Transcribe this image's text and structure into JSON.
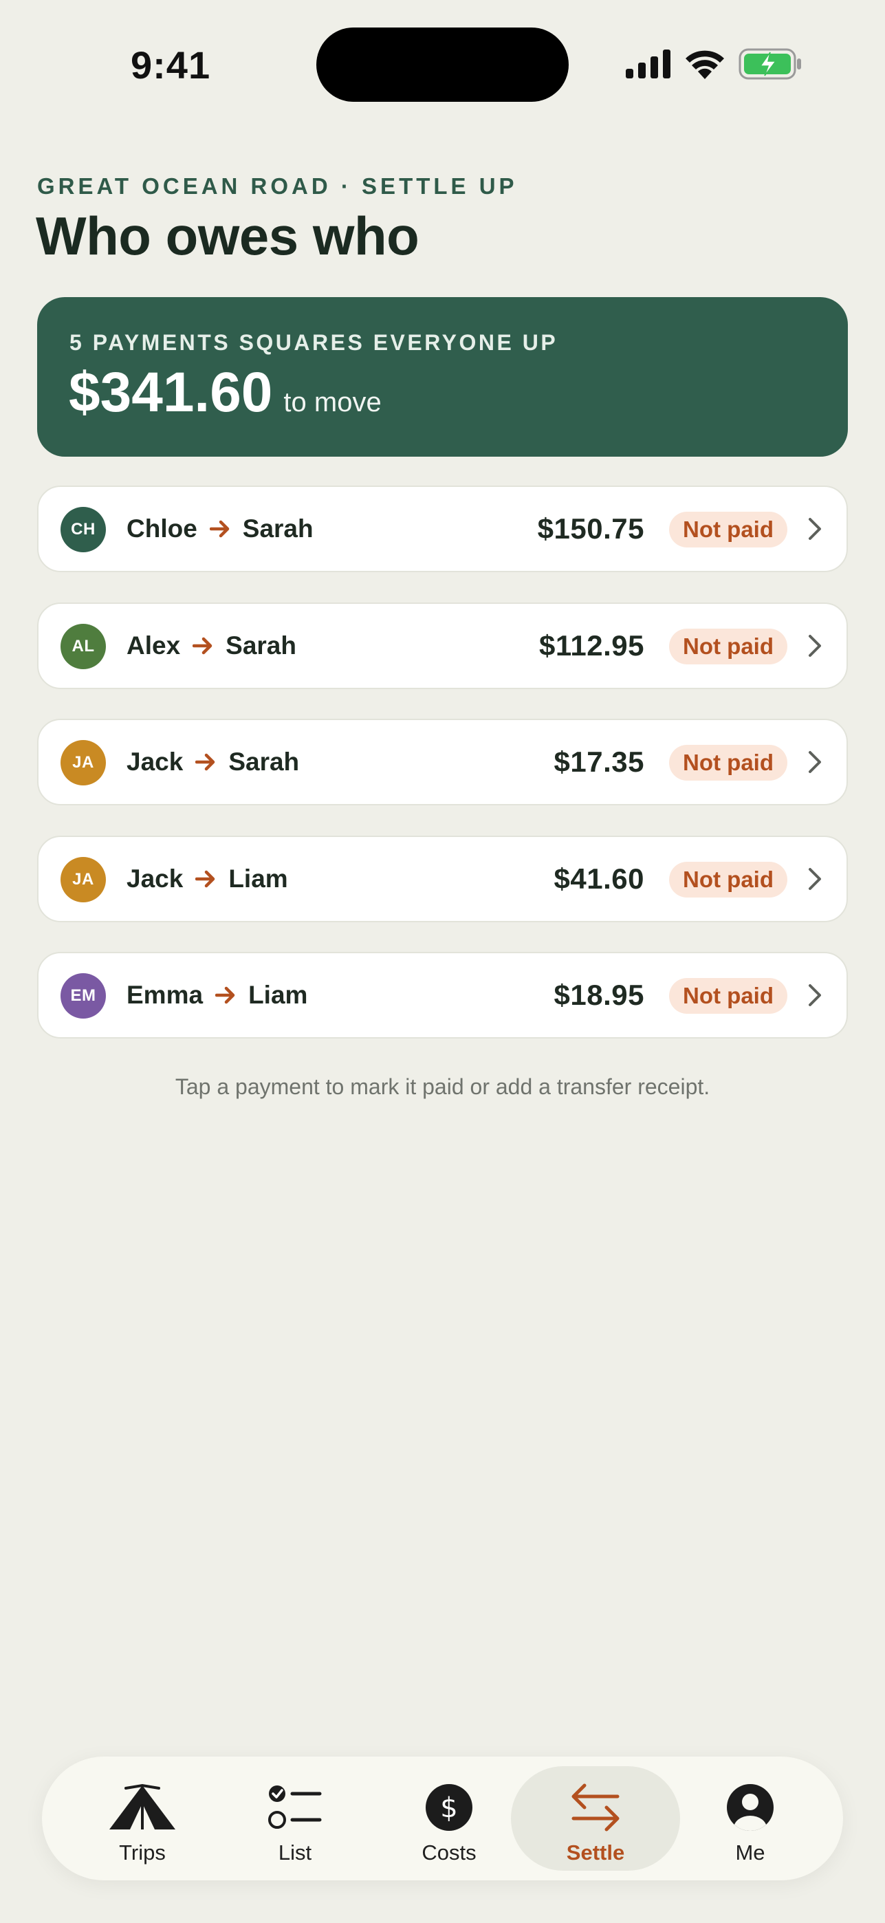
{
  "status_bar": {
    "time": "9:41"
  },
  "header": {
    "eyebrow": "GREAT OCEAN ROAD · SETTLE UP",
    "title": "Who owes who"
  },
  "summary": {
    "label": "5 PAYMENTS SQUARES EVERYONE UP",
    "amount": "$341.60",
    "suffix": "to move"
  },
  "payments": [
    {
      "initials": "CH",
      "from": "Chloe",
      "to": "Sarah",
      "amount": "$150.75",
      "status": "Not paid",
      "avatar_color": "#2f5e4c"
    },
    {
      "initials": "AL",
      "from": "Alex",
      "to": "Sarah",
      "amount": "$112.95",
      "status": "Not paid",
      "avatar_color": "#4f7d3e"
    },
    {
      "initials": "JA",
      "from": "Jack",
      "to": "Sarah",
      "amount": "$17.35",
      "status": "Not paid",
      "avatar_color": "#c98a23"
    },
    {
      "initials": "JA",
      "from": "Jack",
      "to": "Liam",
      "amount": "$41.60",
      "status": "Not paid",
      "avatar_color": "#c98a23"
    },
    {
      "initials": "EM",
      "from": "Emma",
      "to": "Liam",
      "amount": "$18.95",
      "status": "Not paid",
      "avatar_color": "#7a59a3"
    }
  ],
  "hint": "Tap a payment to mark it paid or add a transfer receipt.",
  "tabs": [
    {
      "label": "Trips",
      "icon": "tent-icon"
    },
    {
      "label": "List",
      "icon": "checklist-icon"
    },
    {
      "label": "Costs",
      "icon": "dollar-icon"
    },
    {
      "label": "Settle",
      "icon": "swap-arrows-icon",
      "active": true
    },
    {
      "label": "Me",
      "icon": "person-icon"
    }
  ],
  "colors": {
    "background": "#efefe8",
    "brand_green": "#305e4d",
    "accent_orange": "#b3501f",
    "badge_bg": "#fbe6da"
  }
}
